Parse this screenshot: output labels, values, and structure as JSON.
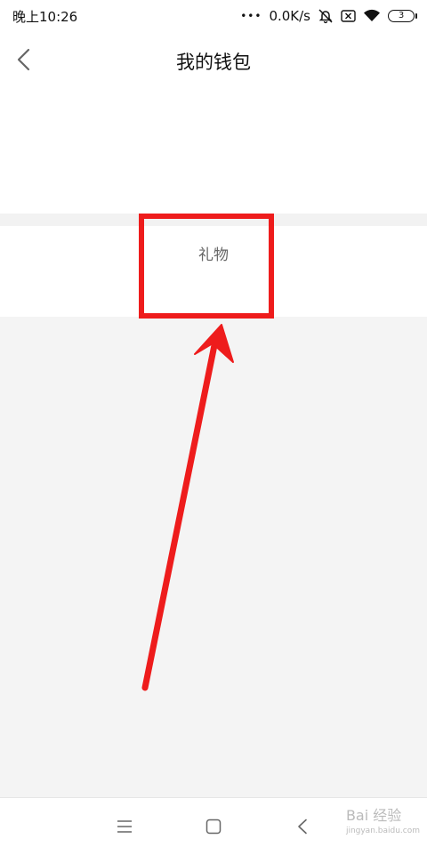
{
  "status": {
    "time": "晚上10:26",
    "dots": "•••",
    "speed": "0.0K/s",
    "battery": "3"
  },
  "header": {
    "title": "我的钱包",
    "back_icon": "chevron-left-icon"
  },
  "gift": {
    "label": "礼物"
  },
  "annotation": {
    "box_color": "#ee1c1c",
    "arrow_color": "#ee1c1c"
  },
  "bottom_nav": {
    "menu_icon": "menu-icon",
    "home_icon": "home-square-icon",
    "back_icon": "back-chevron-icon"
  },
  "watermark": {
    "text": "Bai 经验",
    "url": "jingyan.baidu.com"
  }
}
